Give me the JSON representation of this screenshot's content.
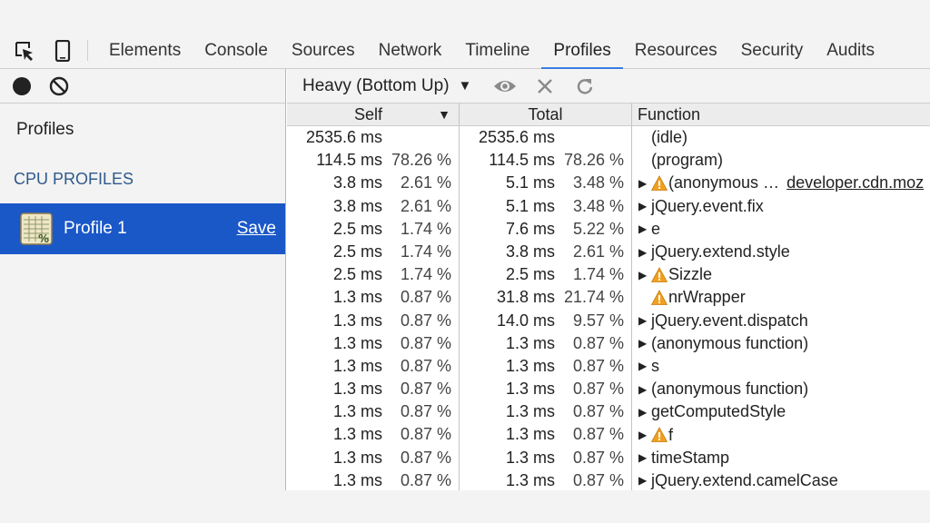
{
  "tabs": [
    "Elements",
    "Console",
    "Sources",
    "Network",
    "Timeline",
    "Profiles",
    "Resources",
    "Security",
    "Audits"
  ],
  "active_tab": "Profiles",
  "sidebar": {
    "heading": "Profiles",
    "section": "CPU PROFILES",
    "profile_name": "Profile 1",
    "save_label": "Save"
  },
  "toolbar": {
    "mode_label": "Heavy (Bottom Up)",
    "mode_caret": "▼"
  },
  "columns": {
    "self": "Self",
    "total": "Total",
    "function": "Function",
    "sort_caret": "▼"
  },
  "rows": [
    {
      "self_ms": "2535.6 ms",
      "self_pct": "",
      "total_ms": "2535.6 ms",
      "total_pct": "",
      "expand": false,
      "warn": false,
      "name": "(idle)",
      "link": ""
    },
    {
      "self_ms": "114.5 ms",
      "self_pct": "78.26 %",
      "total_ms": "114.5 ms",
      "total_pct": "78.26 %",
      "expand": false,
      "warn": false,
      "name": "(program)",
      "link": ""
    },
    {
      "self_ms": "3.8 ms",
      "self_pct": "2.61 %",
      "total_ms": "5.1 ms",
      "total_pct": "3.48 %",
      "expand": true,
      "warn": true,
      "name": "(anonymous …",
      "link": "developer.cdn.moz"
    },
    {
      "self_ms": "3.8 ms",
      "self_pct": "2.61 %",
      "total_ms": "5.1 ms",
      "total_pct": "3.48 %",
      "expand": true,
      "warn": false,
      "name": "jQuery.event.fix",
      "link": ""
    },
    {
      "self_ms": "2.5 ms",
      "self_pct": "1.74 %",
      "total_ms": "7.6 ms",
      "total_pct": "5.22 %",
      "expand": true,
      "warn": false,
      "name": "e",
      "link": ""
    },
    {
      "self_ms": "2.5 ms",
      "self_pct": "1.74 %",
      "total_ms": "3.8 ms",
      "total_pct": "2.61 %",
      "expand": true,
      "warn": false,
      "name": "jQuery.extend.style",
      "link": ""
    },
    {
      "self_ms": "2.5 ms",
      "self_pct": "1.74 %",
      "total_ms": "2.5 ms",
      "total_pct": "1.74 %",
      "expand": true,
      "warn": true,
      "name": "Sizzle",
      "link": ""
    },
    {
      "self_ms": "1.3 ms",
      "self_pct": "0.87 %",
      "total_ms": "31.8 ms",
      "total_pct": "21.74 %",
      "expand": false,
      "warn": true,
      "name": "nrWrapper",
      "link": ""
    },
    {
      "self_ms": "1.3 ms",
      "self_pct": "0.87 %",
      "total_ms": "14.0 ms",
      "total_pct": "9.57 %",
      "expand": true,
      "warn": false,
      "name": "jQuery.event.dispatch",
      "link": ""
    },
    {
      "self_ms": "1.3 ms",
      "self_pct": "0.87 %",
      "total_ms": "1.3 ms",
      "total_pct": "0.87 %",
      "expand": true,
      "warn": false,
      "name": "(anonymous function)",
      "link": ""
    },
    {
      "self_ms": "1.3 ms",
      "self_pct": "0.87 %",
      "total_ms": "1.3 ms",
      "total_pct": "0.87 %",
      "expand": true,
      "warn": false,
      "name": "s",
      "link": ""
    },
    {
      "self_ms": "1.3 ms",
      "self_pct": "0.87 %",
      "total_ms": "1.3 ms",
      "total_pct": "0.87 %",
      "expand": true,
      "warn": false,
      "name": "(anonymous function)",
      "link": ""
    },
    {
      "self_ms": "1.3 ms",
      "self_pct": "0.87 %",
      "total_ms": "1.3 ms",
      "total_pct": "0.87 %",
      "expand": true,
      "warn": false,
      "name": "getComputedStyle",
      "link": ""
    },
    {
      "self_ms": "1.3 ms",
      "self_pct": "0.87 %",
      "total_ms": "1.3 ms",
      "total_pct": "0.87 %",
      "expand": true,
      "warn": true,
      "name": "f",
      "link": ""
    },
    {
      "self_ms": "1.3 ms",
      "self_pct": "0.87 %",
      "total_ms": "1.3 ms",
      "total_pct": "0.87 %",
      "expand": true,
      "warn": false,
      "name": "timeStamp",
      "link": ""
    },
    {
      "self_ms": "1.3 ms",
      "self_pct": "0.87 %",
      "total_ms": "1.3 ms",
      "total_pct": "0.87 %",
      "expand": true,
      "warn": false,
      "name": "jQuery.extend.camelCase",
      "link": ""
    }
  ],
  "colors": {
    "selection": "#1a58c8",
    "active_tab_underline": "#3b7ee1",
    "section_heading": "#2f5a8c",
    "warning": "#f0a020"
  },
  "icons": [
    "inspect-element-icon",
    "device-mode-icon",
    "record-icon",
    "clear-icon",
    "profile-sheet-icon",
    "eye-icon",
    "close-icon",
    "reload-icon",
    "warning-icon",
    "expand-triangle-icon"
  ]
}
